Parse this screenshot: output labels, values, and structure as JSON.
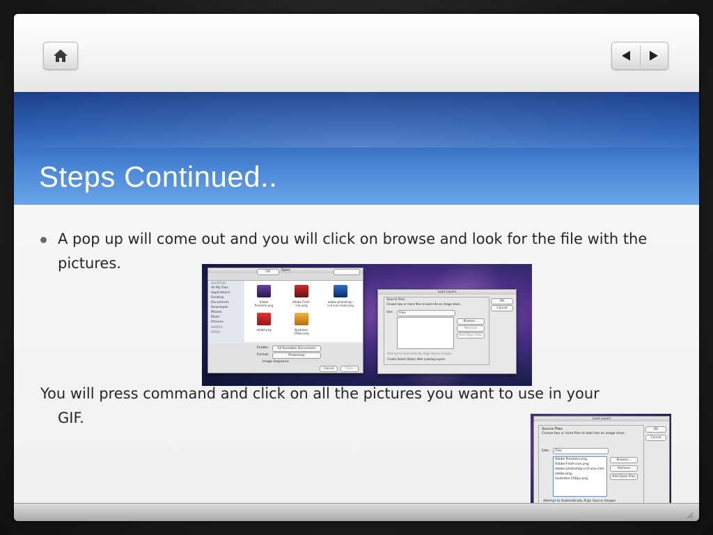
{
  "slide": {
    "title": "Steps Continued..",
    "bullet": "A pop up will come out and you will click on browse and look for the file with the pictures.",
    "paragraph_line1": "You will press command and click on all the pictures you want to use in your",
    "paragraph_line2": "GIF."
  },
  "nav": {
    "home_icon": "home-icon",
    "prev_icon": "triangle-left-icon",
    "next_icon": "triangle-right-icon"
  },
  "open_dialog": {
    "title": "Open",
    "folder": "GIF",
    "sidebar_header": "FAVORITES",
    "sidebar": [
      "All My Files",
      "Applications",
      "Desktop",
      "Documents",
      "Downloads",
      "Movies",
      "Music",
      "Pictures"
    ],
    "shared_header": "SHARED",
    "media_header": "MEDIA",
    "files": [
      "Adobe Premiere.png",
      "Adobe-Flash-icon.png",
      "adobe-photoshop-cs3-icon-clean.png",
      "adobe.png",
      "illustrator-256px.png"
    ],
    "enable_label": "Enable:",
    "enable_value": "All Readable Documents",
    "format_label": "Format:",
    "format_value": "Photoshop",
    "image_sequence": "Image Sequence",
    "cancel": "Cancel",
    "open": "Open"
  },
  "load_layers": {
    "title": "Load Layers",
    "group": "Source Files",
    "hint": "Choose two or more files to load into an image stack.",
    "use_label": "Use:",
    "use_value": "Files",
    "browse": "Browse...",
    "remove": "Remove",
    "add_open": "Add Open Files",
    "ok": "OK",
    "cancel": "Cancel",
    "align": "Attempt to Automatically Align Source Images",
    "smart": "Create Smart Object after Loading Layers",
    "file_list": [
      "Adobe Premiere.png",
      "Adobe-Flash-icon.png",
      "adobe-photoshop-cs3-icon-clea",
      "adobe.png",
      "illustrator-256px.png"
    ]
  }
}
